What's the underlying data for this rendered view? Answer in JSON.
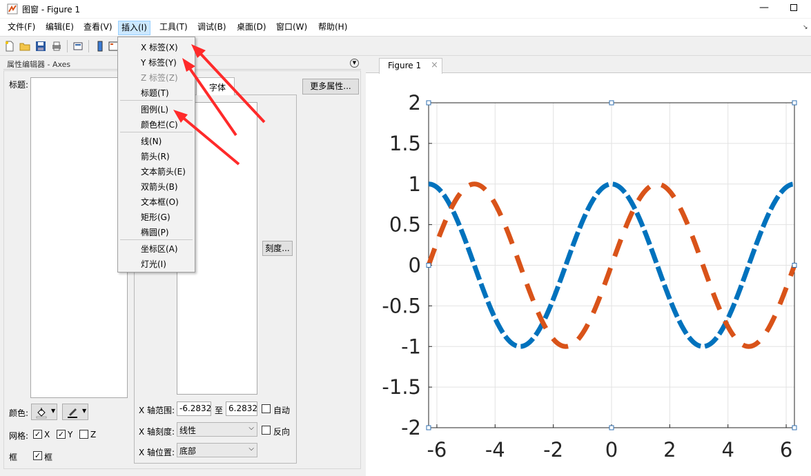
{
  "window": {
    "title": "图窗 - Figure 1",
    "minimize": "—"
  },
  "menubar": [
    {
      "label": "文件(F)"
    },
    {
      "label": "编辑(E)"
    },
    {
      "label": "查看(V)"
    },
    {
      "label": "插入(I)"
    },
    {
      "label": "工具(T)"
    },
    {
      "label": "调试(B)"
    },
    {
      "label": "桌面(D)"
    },
    {
      "label": "窗口(W)"
    },
    {
      "label": "帮助(H)"
    }
  ],
  "insert_menu": {
    "items": [
      {
        "label": "X 标签(X)",
        "enabled": true
      },
      {
        "label": "Y 标签(Y)",
        "enabled": true
      },
      {
        "label": "Z 标签(Z)",
        "enabled": false
      },
      {
        "label": "标题(T)",
        "enabled": true
      },
      {
        "label": "图例(L)",
        "enabled": true
      },
      {
        "label": "颜色栏(C)",
        "enabled": true
      },
      {
        "label": "线(N)",
        "enabled": true
      },
      {
        "label": "箭头(R)",
        "enabled": true
      },
      {
        "label": "文本箭头(E)",
        "enabled": true
      },
      {
        "label": "双箭头(B)",
        "enabled": true
      },
      {
        "label": "文本框(O)",
        "enabled": true
      },
      {
        "label": "矩形(G)",
        "enabled": true
      },
      {
        "label": "椭圆(P)",
        "enabled": true
      },
      {
        "label": "坐标区(A)",
        "enabled": true
      },
      {
        "label": "灯光(I)",
        "enabled": true
      }
    ]
  },
  "property_editor": {
    "title": "属性编辑器 - Axes",
    "title_label": "标题:",
    "tab_font": "字体",
    "more_props": "更多属性...",
    "ticks_btn": "刻度...",
    "color_label": "颜色:",
    "grid_label": "网格:",
    "grid_x": "X",
    "grid_y": "Y",
    "grid_z": "Z",
    "box_label": "框",
    "box_cb": "框",
    "xlim_label": "X 轴范围:",
    "xlim_min": "-6.2832",
    "xlim_to": "至",
    "xlim_max": "6.2832",
    "auto_label": "自动",
    "xscale_label": "X 轴刻度:",
    "xscale_value": "线性",
    "reverse_label": "反向",
    "xloc_label": "X 轴位置:",
    "xloc_value": "底部"
  },
  "figure_tab": {
    "label": "Figure 1",
    "close": "×"
  },
  "chart_data": {
    "type": "line",
    "xlim": [
      -6.2832,
      6.2832
    ],
    "ylim": [
      -2,
      2
    ],
    "xticks": [
      "-6",
      "-4",
      "-2",
      "0",
      "2",
      "4",
      "6"
    ],
    "yticks": [
      "2",
      "1.5",
      "1",
      "0.5",
      "0",
      "-0.5",
      "-1",
      "-1.5",
      "-2"
    ],
    "grid": true,
    "series": [
      {
        "function": "cos(x)",
        "color": "#0072bd",
        "style": "dash-dot",
        "x": [
          -6.2832,
          -3.1416,
          0,
          3.1416,
          6.2832
        ],
        "values": [
          1,
          -1,
          1,
          -1,
          1
        ]
      },
      {
        "function": "sin(x)",
        "color": "#d95319",
        "style": "dashed",
        "x": [
          -6.2832,
          -4.7124,
          -1.5708,
          1.5708,
          4.7124,
          6.2832
        ],
        "values": [
          0,
          1,
          -1,
          1,
          -1,
          0
        ]
      }
    ]
  },
  "annotations": {
    "arrow_color": "#ff2a2a",
    "arrow_count": 3
  }
}
